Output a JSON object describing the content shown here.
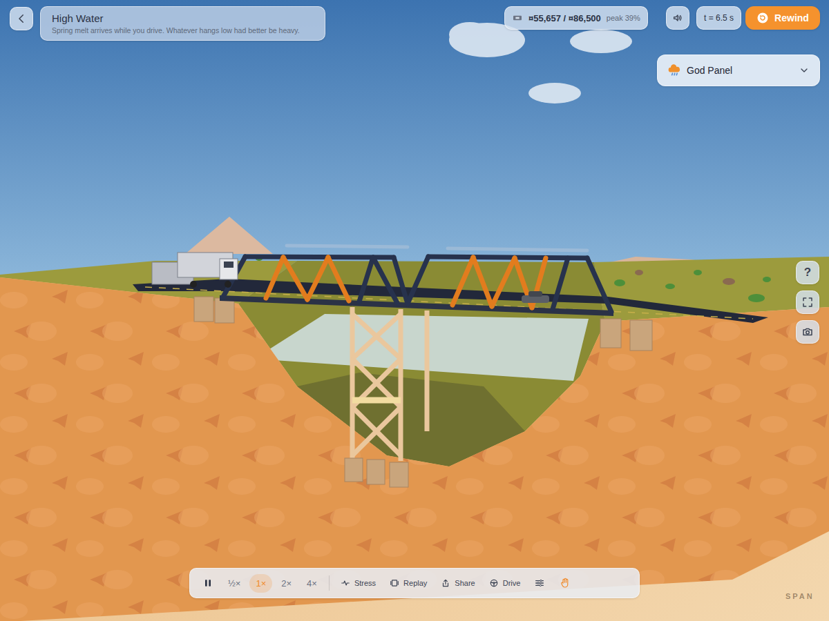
{
  "header": {
    "title": "High Water",
    "subtitle": "Spring melt arrives while you drive. Whatever hangs low had better be heavy."
  },
  "budget": {
    "amount": "¤55,657 / ¤86,500",
    "peak": "peak 39%"
  },
  "time": "t = 6.5 s",
  "rewind": "Rewind",
  "god_panel": {
    "label": "God Panel",
    "expanded": false
  },
  "side_buttons": {
    "help": "?"
  },
  "toolbar": {
    "paused": false,
    "speeds": [
      {
        "label": "½×",
        "selected": false
      },
      {
        "label": "1×",
        "selected": true
      },
      {
        "label": "2×",
        "selected": false
      },
      {
        "label": "4×",
        "selected": false
      }
    ],
    "actions": [
      "Stress",
      "Replay",
      "Share",
      "Drive"
    ]
  },
  "watermark": "SPAN"
}
